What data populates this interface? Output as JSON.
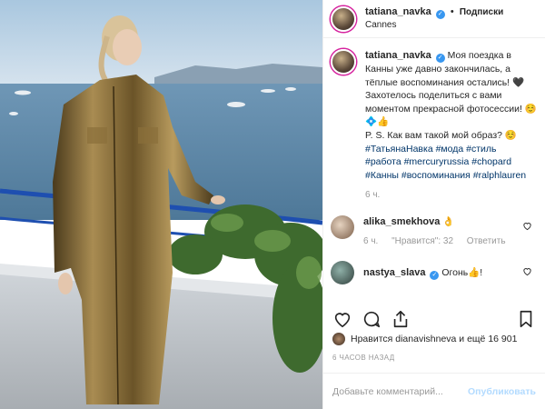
{
  "post": {
    "username": "tatiana_navka",
    "follow_label": "Подписки",
    "location": "Cannes"
  },
  "caption": {
    "username": "tatiana_navka",
    "text1": "Моя поездка в Канны уже давно закончилась, а тёплые воспоминания остались! 🖤 Захотелось поделиться с вами моментом прекрасной фотосессии! ☺️💠👍",
    "text2": "P. S. Как вам такой мой образ? ☺️",
    "hashtags_line1": "#ТатьянаНавка #мода #стиль",
    "hashtags_line2": "#работа #mercuryrussia #chopard",
    "hashtags_line3": "#Канны #воспоминания #ralphlauren",
    "time": "6 ч."
  },
  "comments": [
    {
      "username": "alika_smekhova",
      "text": "👌",
      "time": "6 ч.",
      "likes": "\"Нравится\": 32",
      "reply": "Ответить"
    },
    {
      "username": "nastya_slava",
      "text": "Огонь👍!"
    }
  ],
  "likes_text": "Нравится dianavishneva и ещё 16 901",
  "ago": "6 ЧАСОВ НАЗАД",
  "comment_input": {
    "placeholder": "Добавьте комментарий..."
  },
  "publish_label": "Опубликовать"
}
